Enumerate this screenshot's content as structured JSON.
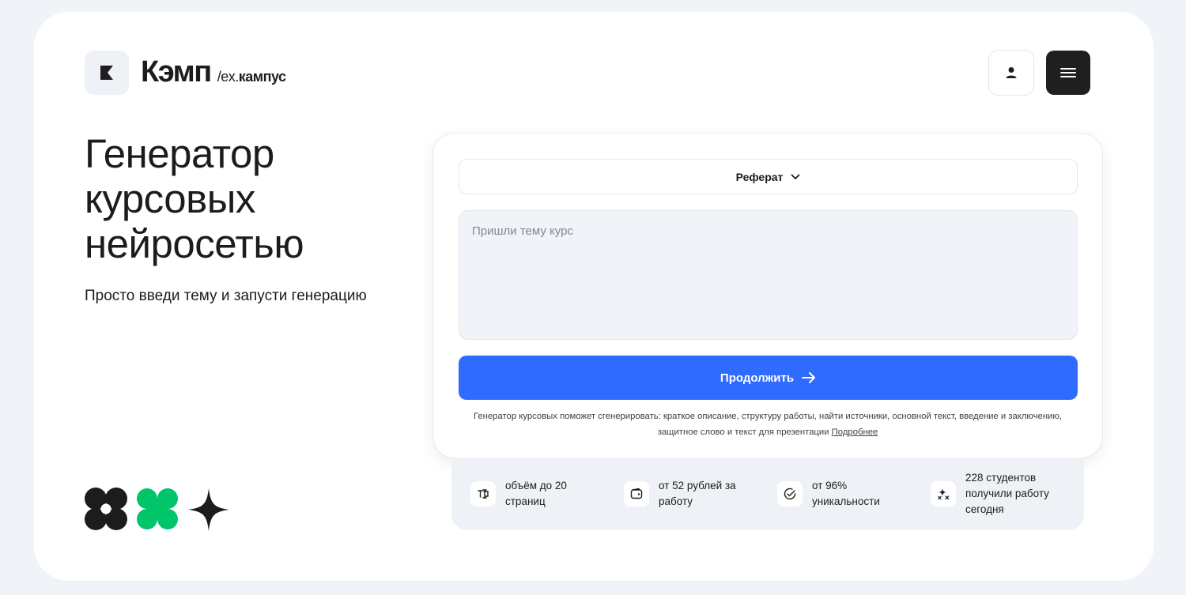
{
  "header": {
    "brand_name": "Кэмп",
    "brand_ex_prefix": "/ex.",
    "brand_ex_name": "кампус",
    "icons": {
      "logo": "k-logo-icon",
      "user": "user-icon",
      "menu": "hamburger-menu-icon"
    }
  },
  "hero": {
    "title_lines": [
      "Генератор",
      "курсовых",
      "нейросетью"
    ],
    "subtitle": "Просто введи тему и запусти генерацию"
  },
  "form": {
    "work_type_selected": "Реферат",
    "topic_placeholder": "Пришли тему курс",
    "topic_value": "",
    "continue_label": "Продолжить",
    "note_text": "Генератор курсовых поможет сгенерировать: краткое описание, структуру работы, найти источники, основной текст, введение и заключению, защитное слово и текст для презентации",
    "note_link": "Подробнее"
  },
  "stats": [
    {
      "icon": "text-cursor-icon",
      "lines": [
        "объём до 20",
        "страниц"
      ]
    },
    {
      "icon": "wallet-icon",
      "lines": [
        "от 52 рублей за",
        "работу"
      ]
    },
    {
      "icon": "check-circle-icon",
      "lines": [
        "от 96%",
        "уникальности"
      ]
    },
    {
      "icon": "sparkles-icon",
      "lines": [
        "228 студентов",
        "получили работу",
        "сегодня"
      ]
    }
  ],
  "colors": {
    "accent": "#2f6bff",
    "green": "#00c56a",
    "dark": "#1f1f1f",
    "background": "#f0f4f8"
  }
}
